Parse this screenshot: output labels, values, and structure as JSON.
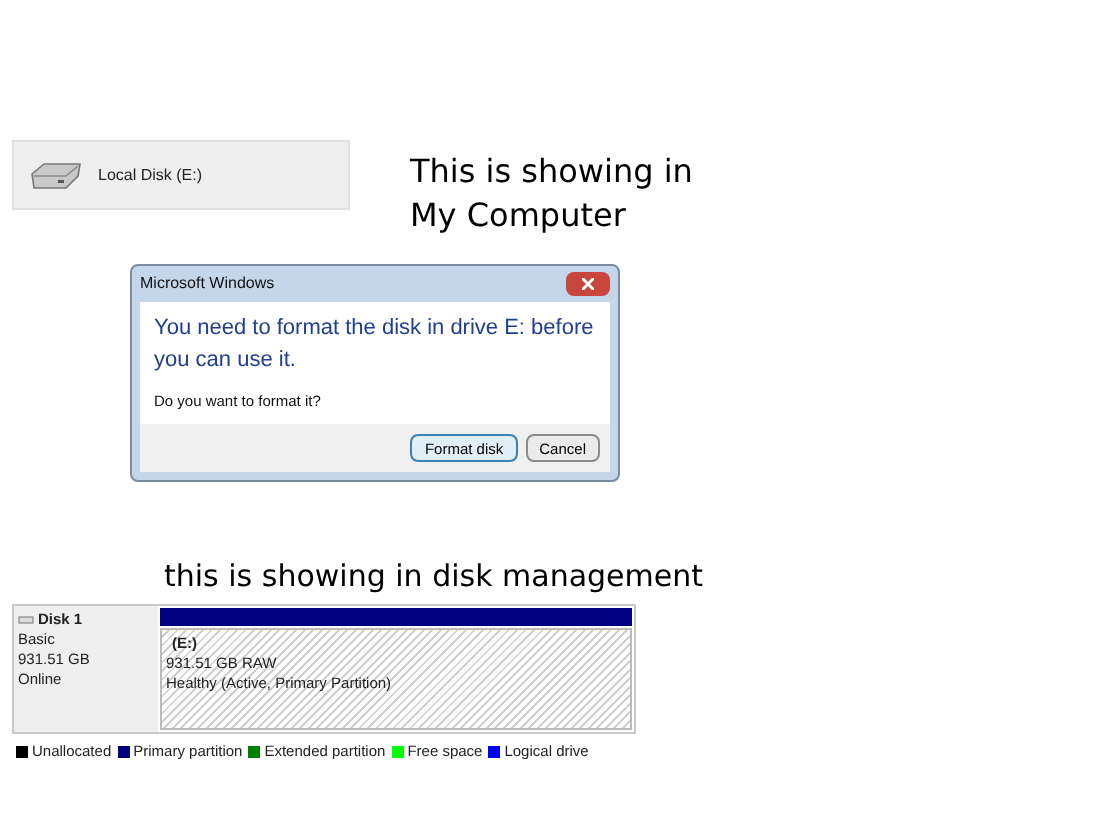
{
  "drive_tile": {
    "label": "Local Disk (E:)"
  },
  "note_1": "This is showing in My Computer",
  "dialog": {
    "title": "Microsoft Windows",
    "message": "You need to format the disk in drive E: before you can use it.",
    "question": "Do you want to format it?",
    "buttons": [
      {
        "label": "Format disk",
        "selected": true
      },
      {
        "label": "Cancel",
        "selected": false
      }
    ]
  },
  "note_2": "this is showing in disk management",
  "disk_management": {
    "disk": {
      "name": "Disk 1",
      "type": "Basic",
      "size": "931.51 GB",
      "status": "Online"
    },
    "partition": {
      "name": "(E:)",
      "size": "931.51 GB RAW",
      "health": "Healthy (Active, Primary Partition)"
    },
    "legend": [
      {
        "label": "Unallocated",
        "color": "#000000"
      },
      {
        "label": "Primary partition",
        "color": "#000080"
      },
      {
        "label": "Extended partition",
        "color": "#008000"
      },
      {
        "label": "Free space",
        "color": "#00ff00"
      },
      {
        "label": "Logical drive",
        "color": "#0000ff"
      }
    ]
  }
}
